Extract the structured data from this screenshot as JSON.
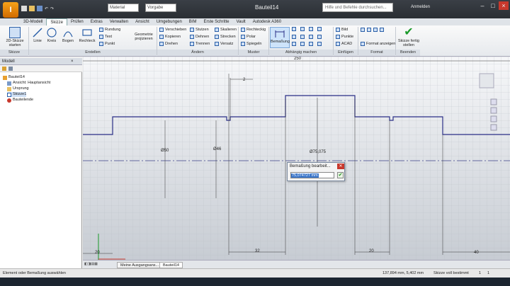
{
  "titlebar": {
    "app_letter": "I",
    "material_combo": "Material",
    "appearance_combo": "Vorgabe",
    "doc_title": "Bauteil14",
    "help_search_placeholder": "Hilfe und Befehle durchsuchen...",
    "user_label": "Anmelden"
  },
  "tabs": [
    "3D-Modell",
    "Skizze",
    "Prüfen",
    "Extras",
    "Verwalten",
    "Ansicht",
    "Umgebungen",
    "BIM",
    "Erste Schritte",
    "Vault",
    "Autodesk A360"
  ],
  "active_tab": "Skizze",
  "ribbon": {
    "skizze": {
      "big_label": "2D-Skizze starten",
      "title": "Skizze"
    },
    "erstellen": {
      "title": "Erstellen",
      "big": [
        "Linie",
        "Kreis",
        "Bogen",
        "Rechteck"
      ],
      "small": [
        "Rundung",
        "Text",
        "Punkt"
      ],
      "geometry": "Geometrie projizieren"
    },
    "aendern": {
      "title": "Ändern",
      "items": [
        "Verschieben",
        "Kopieren",
        "Drehen",
        "Stutzen",
        "Dehnen",
        "Trennen",
        "Skalieren",
        "Strecken",
        "Versatz"
      ]
    },
    "muster": {
      "title": "Muster",
      "items": [
        "Rechteckig",
        "Polar",
        "Spiegeln"
      ]
    },
    "abhaengig": {
      "title": "Abhängig machen",
      "big": "Bemaßung"
    },
    "einfuegen": {
      "title": "Einfügen",
      "items": [
        "Bild",
        "Punkte",
        "ACAD"
      ]
    },
    "format": {
      "title": "Format",
      "items": [
        "Format anzeigen"
      ]
    },
    "beenden": {
      "title": "Beenden",
      "big": "Skizze fertig stellen"
    }
  },
  "browser": {
    "header": "Modell",
    "tree": [
      {
        "label": "Bauteil14",
        "indent": 0,
        "icon": "part-icon"
      },
      {
        "label": "Ansicht: Hauptansicht",
        "indent": 1,
        "icon": "view-icon"
      },
      {
        "label": "Ursprung",
        "indent": 1,
        "icon": "folder-icon"
      },
      {
        "label": "Skizze1",
        "indent": 1,
        "icon": "sketch-icon"
      },
      {
        "label": "Bauteilende",
        "indent": 1,
        "icon": "end-of-part-icon"
      }
    ]
  },
  "sketch": {
    "top_dim": "250",
    "dim_2": "2",
    "dia_50": "Ø50",
    "dia_46": "Ø46",
    "dia_75": "Ø75,075",
    "dim_20_left": "20",
    "dim_32": "32",
    "dim_20_right": "20",
    "dim_40": "40"
  },
  "dialog": {
    "title": "Bemaßung bearbeit...",
    "value": "75,074727 mm",
    "ok_symbol": "✔",
    "close_symbol": "✕"
  },
  "doc_tabs": [
    "Meine Ausgangsans...",
    "Bauteil14"
  ],
  "status": {
    "left": "Element oder Bemaßung auswählen",
    "coords": "137,894 mm, 5,402 mm",
    "state": "Skizze voll bestimmt",
    "count1": "1",
    "count2": "1"
  },
  "colors": {
    "sketch_line": "#2a2f86",
    "accent": "#2a5fa8",
    "app_orange": "#e88a10"
  }
}
